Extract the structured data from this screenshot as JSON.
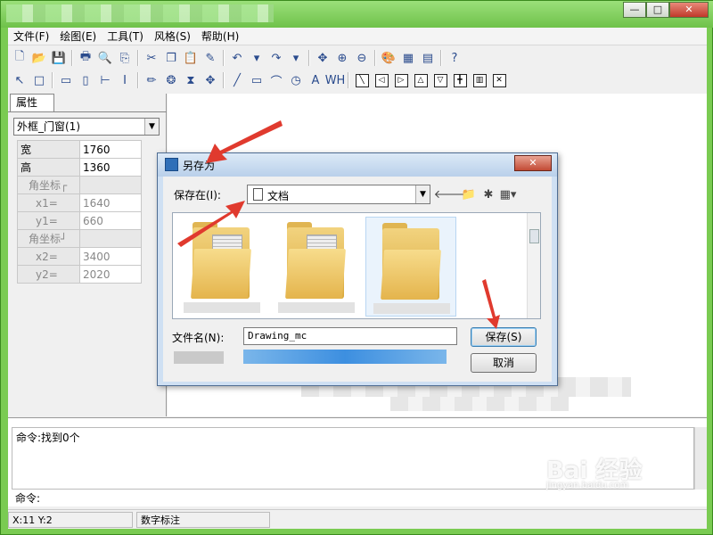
{
  "menu": [
    "文件(F)",
    "绘图(E)",
    "工具(T)",
    "风格(S)",
    "帮助(H)"
  ],
  "window_controls": {
    "minimize": "—",
    "maximize": "□",
    "close": "✕"
  },
  "properties_panel": {
    "tab_label": "属性",
    "object_combo": "外框_门窗(1)",
    "rows": [
      {
        "key": "宽",
        "value": "1760"
      },
      {
        "key": "高",
        "value": "1360"
      }
    ],
    "group1": "角坐标┌",
    "x1": {
      "key": "x1=",
      "value": "1640"
    },
    "y1": {
      "key": "y1=",
      "value": "660"
    },
    "group2": "角坐标┘",
    "x2": {
      "key": "x2=",
      "value": "3400"
    },
    "y2": {
      "key": "y2=",
      "value": "2020"
    }
  },
  "command": {
    "output": "命令:找到0个",
    "prompt": "命令:"
  },
  "status": {
    "coords": "X:11  Y:2",
    "mode": "数字标注"
  },
  "watermark": {
    "main": "Bai 经验",
    "sub": "jingyan.baidu.com"
  },
  "dialog": {
    "title": "另存为",
    "close": "✕",
    "lookin_label": "保存在(I):",
    "lookin_value": "文档",
    "filename_label": "文件名(N):",
    "filename_value": "Drawing_mc",
    "save_button": "保存(S)",
    "cancel_button": "取消"
  },
  "colors": {
    "frame_green": "#7acb52",
    "annotation_red": "#e03a2e",
    "dialog_frame": "#cfe0f3"
  }
}
